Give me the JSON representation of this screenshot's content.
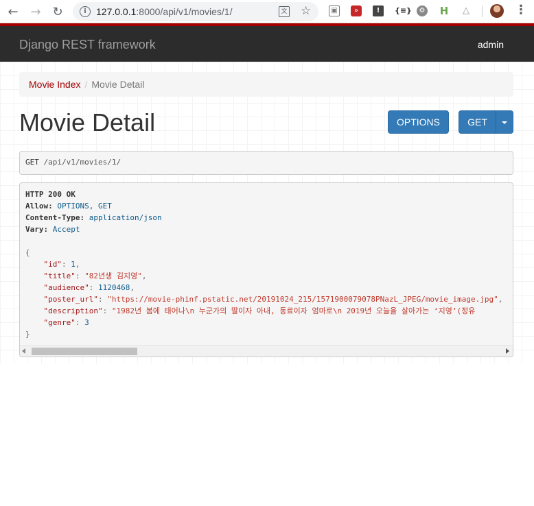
{
  "browser": {
    "url_host": "127.0.0.1",
    "url_rest": ":8000/api/v1/movies/1/",
    "extensions": [
      "media-icon",
      "forward-red-icon",
      "info-dark-icon",
      "json-icon",
      "gear-circle-icon",
      "ladder-green-icon",
      "sitemap-icon"
    ]
  },
  "navbar": {
    "brand": "Django REST framework",
    "user": "admin",
    "accent": "#a30000"
  },
  "breadcrumb": {
    "link": "Movie Index",
    "separator": "/",
    "active": "Movie Detail"
  },
  "page": {
    "title": "Movie Detail"
  },
  "buttons": {
    "options": "OPTIONS",
    "get": "GET"
  },
  "request": {
    "method": "GET",
    "path": "/api/v1/movies/1/"
  },
  "response": {
    "status": "HTTP 200 OK",
    "headers": [
      {
        "name": "Allow:",
        "value": "OPTIONS, GET"
      },
      {
        "name": "Content-Type:",
        "value": "application/json"
      },
      {
        "name": "Vary:",
        "value": "Accept"
      }
    ],
    "open_brace": "{",
    "close_brace": "}",
    "fields": [
      {
        "key": "\"id\"",
        "value": "1",
        "type": "num",
        "comma": ","
      },
      {
        "key": "\"title\"",
        "value": "\"82년생 김지영\"",
        "type": "str",
        "comma": ","
      },
      {
        "key": "\"audience\"",
        "value": "1120468",
        "type": "num",
        "comma": ","
      },
      {
        "key": "\"poster_url\"",
        "value": "\"https://movie-phinf.pstatic.net/20191024_215/1571900079078PNazL_JPEG/movie_image.jpg\"",
        "type": "str",
        "comma": ","
      },
      {
        "key": "\"description\"",
        "value": "\"1982년 봄에 태어나\\n 누군가의 딸이자 아내, 동료이자 엄마로\\n 2019년 오늘을 살아가는 ‘지영’(정유",
        "type": "str",
        "comma": ""
      },
      {
        "key": "\"genre\"",
        "value": "3",
        "type": "num",
        "comma": ""
      }
    ]
  }
}
